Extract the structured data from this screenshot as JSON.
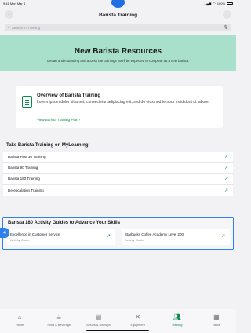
{
  "status_bar": {
    "time": "9:41",
    "date": "Mon Mar 4",
    "battery": "100%"
  },
  "nav": {
    "title": "Barista Training"
  },
  "search": {
    "placeholder": "Search in Training"
  },
  "hero": {
    "title": "New Barista Resources",
    "subtitle": "Get an understanding and access the trainings you'll be expected to complete as a new barista."
  },
  "overview": {
    "title": "Overview of Barista Training",
    "description": "Lorem ipsum dolor sit amet, consectetur adipiscing elit, sed do eiusmod tempor incididunt ut labore.",
    "link": "View Barista Training Plan"
  },
  "mylearning": {
    "title": "Take Barista Training on MyLearning",
    "items": [
      {
        "label": "Barista First 30 Training"
      },
      {
        "label": "Barista 90 Training"
      },
      {
        "label": "Barista 180 Training"
      },
      {
        "label": "De-escalation Training"
      }
    ]
  },
  "guides": {
    "badge": "4",
    "title": "Barista 180 Activity Guides to Advance Your Skills",
    "cards": [
      {
        "title": "Excellence in Customer Service",
        "type": "Activity Guide"
      },
      {
        "title": "Starbucks Coffee Academy Level 200",
        "type": "Activity Guide"
      }
    ]
  },
  "tabs": [
    {
      "label": "Home",
      "icon": "home-icon",
      "active": false
    },
    {
      "label": "Food & Beverage",
      "icon": "cup-icon",
      "active": false
    },
    {
      "label": "Setups & Displays",
      "icon": "clipboard-icon",
      "active": false
    },
    {
      "label": "Equipment",
      "icon": "tools-icon",
      "active": false
    },
    {
      "label": "Training",
      "icon": "people-icon",
      "active": true
    },
    {
      "label": "News",
      "icon": "news-icon",
      "active": false
    }
  ],
  "colors": {
    "accent": "#0d8a4e",
    "hero_bg": "#a8e0cc",
    "highlight": "#2f80ed"
  }
}
